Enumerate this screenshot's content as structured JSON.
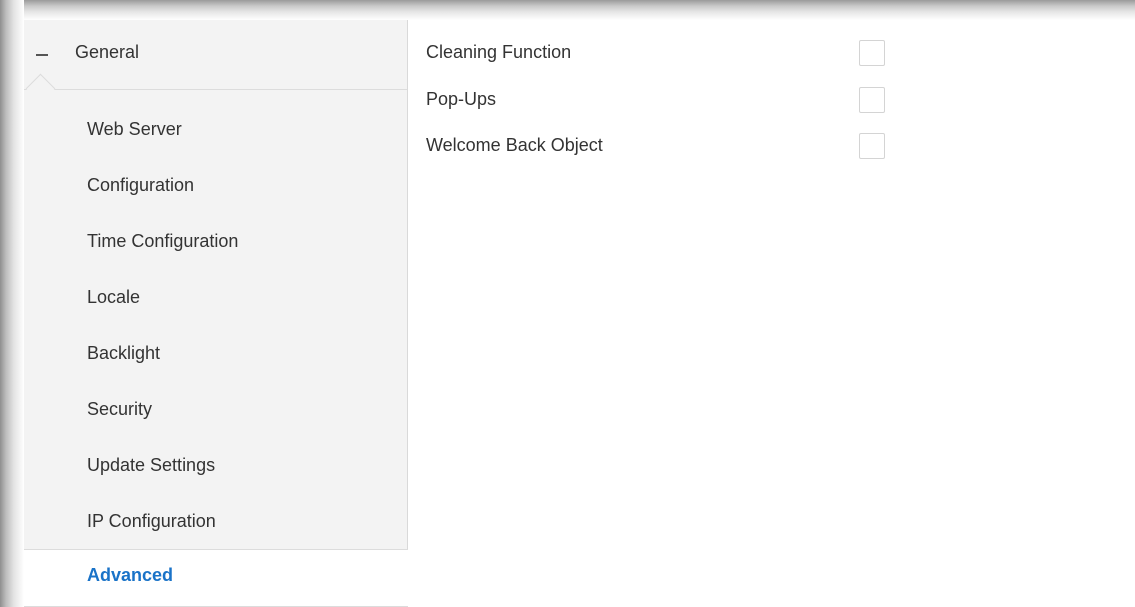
{
  "sidebar": {
    "group": {
      "label": "General",
      "collapse_icon": "minus-icon"
    },
    "items": [
      {
        "label": "Web Server",
        "active": false
      },
      {
        "label": "Configuration",
        "active": false
      },
      {
        "label": "Time Configuration",
        "active": false
      },
      {
        "label": "Locale",
        "active": false
      },
      {
        "label": "Backlight",
        "active": false
      },
      {
        "label": "Security",
        "active": false
      },
      {
        "label": "Update Settings",
        "active": false
      },
      {
        "label": "IP Configuration",
        "active": false
      },
      {
        "label": "Advanced",
        "active": true
      }
    ]
  },
  "main": {
    "options": [
      {
        "label": "Cleaning Function",
        "checked": false
      },
      {
        "label": "Pop-Ups",
        "checked": false
      },
      {
        "label": "Welcome Back Object",
        "checked": false
      }
    ]
  },
  "colors": {
    "active_text": "#1a73c8",
    "sidebar_bg": "#f3f3f3"
  }
}
